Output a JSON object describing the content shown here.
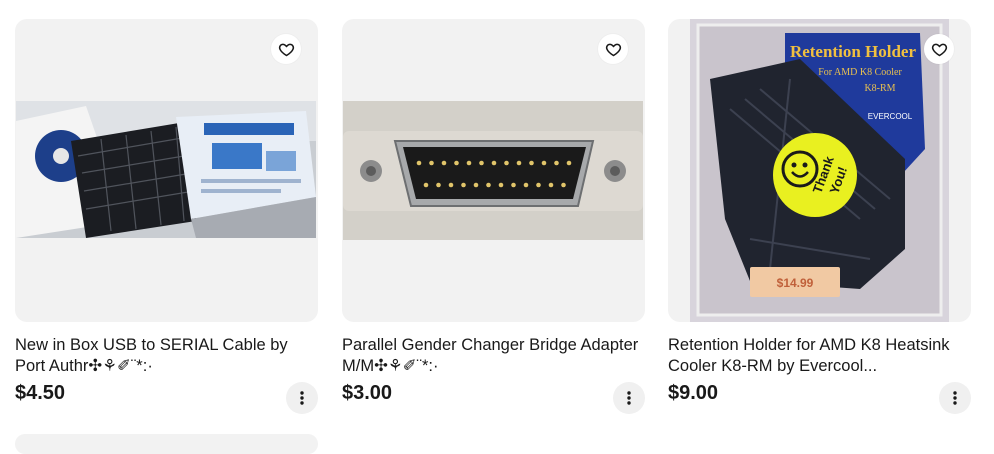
{
  "listings": [
    {
      "title": "New in Box USB to SERIAL Cable by Port Authr✣⚘✐¨*:·",
      "price": "$4.50",
      "watch_icon": "heart-icon",
      "more_icon": "more-vertical-icon"
    },
    {
      "title": "Parallel Gender Changer Bridge Adapter M/M✣⚘✐¨*:·",
      "price": "$3.00",
      "watch_icon": "heart-icon",
      "more_icon": "more-vertical-icon"
    },
    {
      "title": "Retention Holder for AMD K8 Heatsink Cooler K8-RM by Evercool...",
      "price": "$9.00",
      "watch_icon": "heart-icon",
      "more_icon": "more-vertical-icon"
    }
  ],
  "product_image_text": {
    "box_title": "Retention Holder",
    "box_sub1": "For AMD K8 Cooler",
    "box_sub2": "K8-RM",
    "box_brand": "EVERCOOL",
    "sticker_line1": "Thank",
    "sticker_line2": "You!",
    "price_tag": "$14.99"
  },
  "colors": {
    "text": "#191919",
    "tile_bg": "#f2f2f2",
    "sticker": "#e9f020",
    "box_blue": "#1f3a9c",
    "tag": "#f1c9a3"
  }
}
